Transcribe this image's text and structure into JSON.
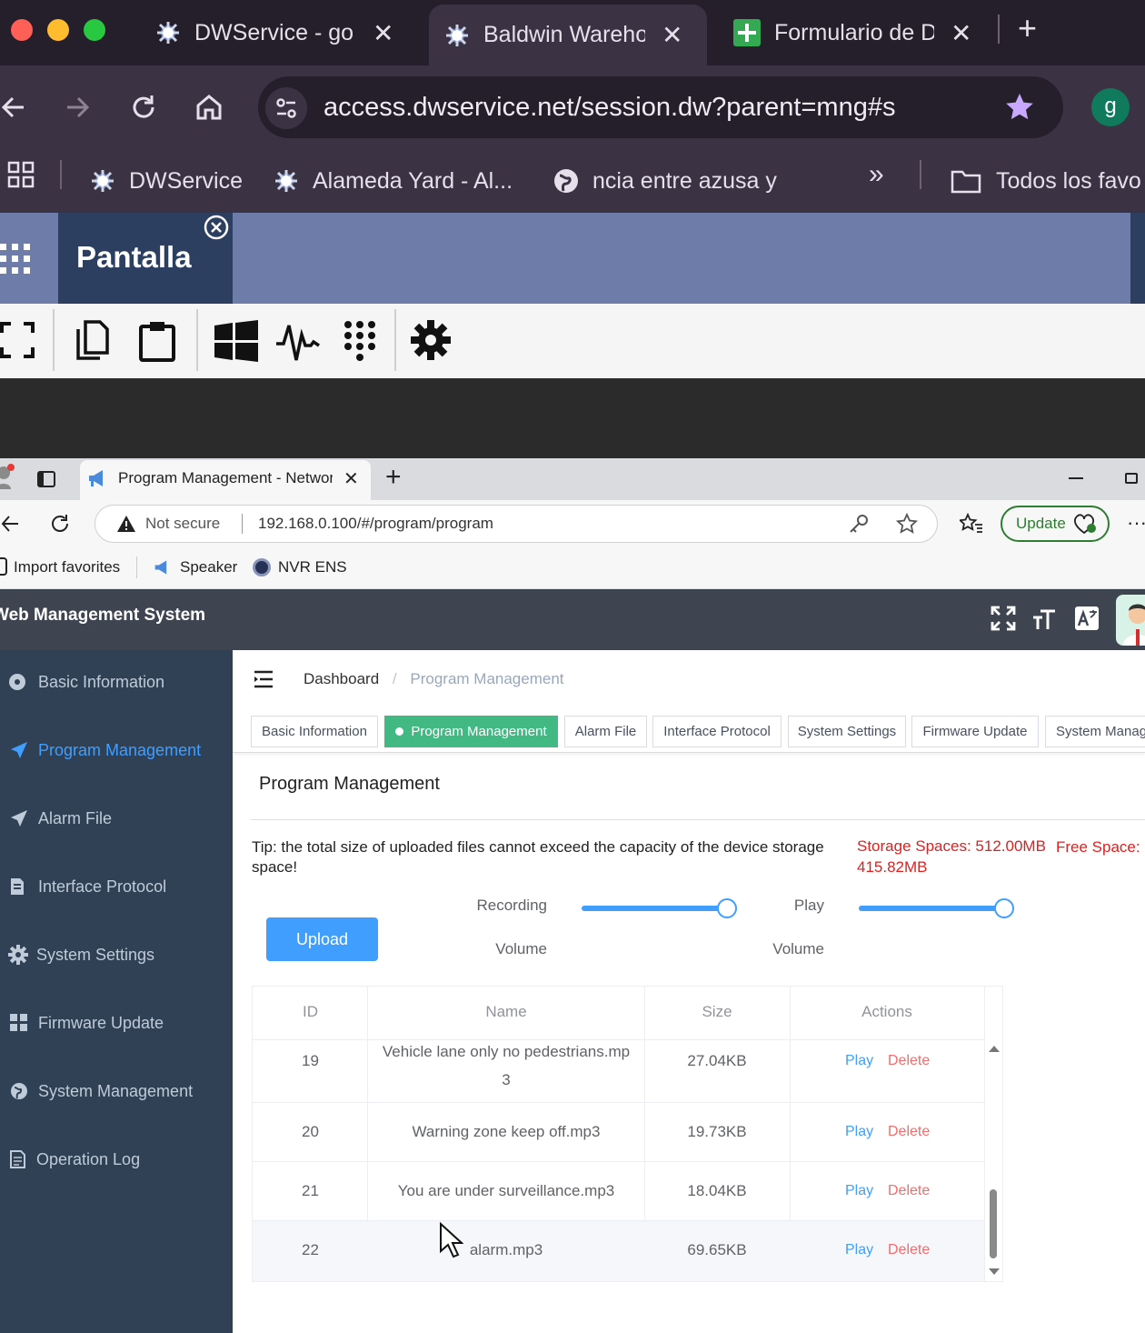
{
  "browser": {
    "tabs": [
      {
        "label": "DWService - go"
      },
      {
        "label": "Baldwin Wareho"
      },
      {
        "label": "Formulario de D"
      }
    ],
    "url": "access.dwservice.net/session.dw?parent=mng#s",
    "avatar": "g",
    "bookmarks": [
      {
        "label": "DWService"
      },
      {
        "label": "Alameda Yard - Al..."
      },
      {
        "label": "ncia entre azusa y"
      }
    ],
    "more": "»",
    "all_bookmarks": "Todos los favo"
  },
  "dwservice": {
    "tab_label": "Pantalla"
  },
  "inner_browser": {
    "tab_label": "Program Management - Network",
    "security": "Not secure",
    "url": "192.168.0.100/#/program/program",
    "update_label": "Update",
    "bookmarks": [
      {
        "label": "Import favorites"
      },
      {
        "label": "Speaker"
      },
      {
        "label": "NVR ENS"
      }
    ]
  },
  "app": {
    "title": "Web Management System",
    "sidebar": [
      {
        "label": "Basic Information"
      },
      {
        "label": "Program Management"
      },
      {
        "label": "Alarm File"
      },
      {
        "label": "Interface Protocol"
      },
      {
        "label": "System Settings"
      },
      {
        "label": "Firmware Update"
      },
      {
        "label": "System Management"
      },
      {
        "label": "Operation Log"
      }
    ],
    "breadcrumb": {
      "home": "Dashboard",
      "sep": "/",
      "current": "Program Management"
    },
    "tags": [
      {
        "label": "Basic Information"
      },
      {
        "label": "Program Management"
      },
      {
        "label": "Alarm File"
      },
      {
        "label": "Interface Protocol"
      },
      {
        "label": "System Settings"
      },
      {
        "label": "Firmware Update"
      },
      {
        "label": "System Manag"
      }
    ],
    "page_title": "Program Management",
    "tip": "Tip: the total size of uploaded files cannot exceed the capacity of the device storage space!",
    "storage": "Storage Spaces: 512.00MB",
    "free": "Free Space: 415.82MB",
    "upload_label": "Upload",
    "recording_label_1": "Recording",
    "recording_label_2": "Volume",
    "recording_volume": 1.0,
    "play_label_1": "Play",
    "play_label_2": "Volume",
    "play_volume": 1.0,
    "table": {
      "headers": [
        "ID",
        "Name",
        "Size",
        "Actions"
      ],
      "rows": [
        {
          "id": "19",
          "name": "Vehicle lane only no pedestrians.mp3",
          "size": "27.04KB",
          "play": "Play",
          "delete": "Delete"
        },
        {
          "id": "20",
          "name": "Warning zone keep off.mp3",
          "size": "19.73KB",
          "play": "Play",
          "delete": "Delete"
        },
        {
          "id": "21",
          "name": "You are under surveillance.mp3",
          "size": "18.04KB",
          "play": "Play",
          "delete": "Delete"
        },
        {
          "id": "22",
          "name": "alarm.mp3",
          "size": "69.65KB",
          "play": "Play",
          "delete": "Delete"
        }
      ]
    }
  },
  "colors": {
    "accent_green": "#42b983",
    "accent_blue": "#409eff",
    "danger_red": "#f56c6c",
    "sidebar_bg": "#304156",
    "sidebar_active": "#409eff"
  }
}
